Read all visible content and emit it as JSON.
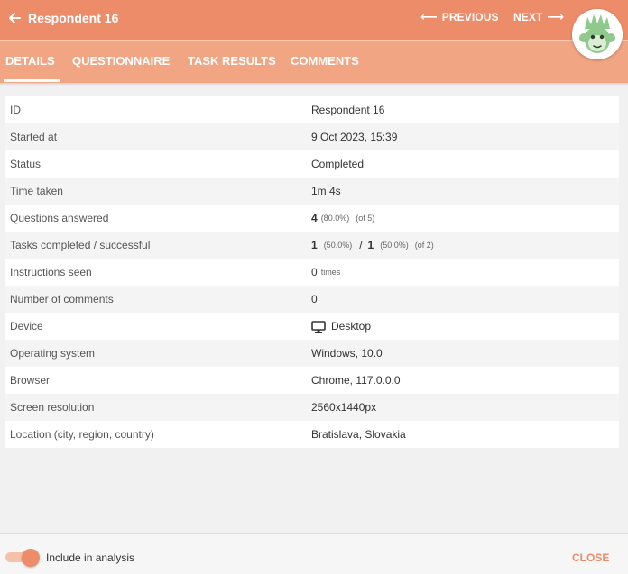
{
  "header": {
    "title": "Respondent 16",
    "previous_label": "PREVIOUS",
    "next_label": "NEXT"
  },
  "tabs": [
    {
      "label": "DETAILS",
      "active": true
    },
    {
      "label": "QUESTIONNAIRE",
      "active": false
    },
    {
      "label": "TASK RESULTS",
      "active": false
    },
    {
      "label": "COMMENTS",
      "active": false
    }
  ],
  "details": {
    "id": {
      "label": "ID",
      "value": "Respondent 16"
    },
    "started_at": {
      "label": "Started at",
      "value": "9 Oct 2023, 15:39"
    },
    "status": {
      "label": "Status",
      "value": "Completed"
    },
    "time_taken": {
      "label": "Time taken",
      "value": "1m 4s"
    },
    "questions_answered": {
      "label": "Questions answered",
      "count": "4",
      "percent": "(80.0%)",
      "of_total": "(of 5)"
    },
    "tasks": {
      "label": "Tasks completed / successful",
      "completed": "1",
      "completed_percent": "(50.0%)",
      "successful": "1",
      "successful_percent": "(50.0%)",
      "of_total": "(of 2)"
    },
    "instructions_seen": {
      "label": "Instructions seen",
      "count": "0",
      "unit": "times"
    },
    "comments": {
      "label": "Number of comments",
      "value": "0"
    },
    "device": {
      "label": "Device",
      "value": "Desktop",
      "icon": "desktop-icon"
    },
    "os": {
      "label": "Operating system",
      "value": "Windows, 10.0"
    },
    "browser": {
      "label": "Browser",
      "value": "Chrome, 117.0.0.0"
    },
    "resolution": {
      "label": "Screen resolution",
      "value": "2560x1440px"
    },
    "location": {
      "label": "Location (city, region, country)",
      "value": "Bratislava, Slovakia"
    }
  },
  "footer": {
    "include_label": "Include in analysis",
    "include_enabled": true,
    "close_label": "CLOSE"
  },
  "colors": {
    "accent": "#ed8c69",
    "tab_bar": "#f1a583",
    "avatar_green": "#8fc98b"
  }
}
